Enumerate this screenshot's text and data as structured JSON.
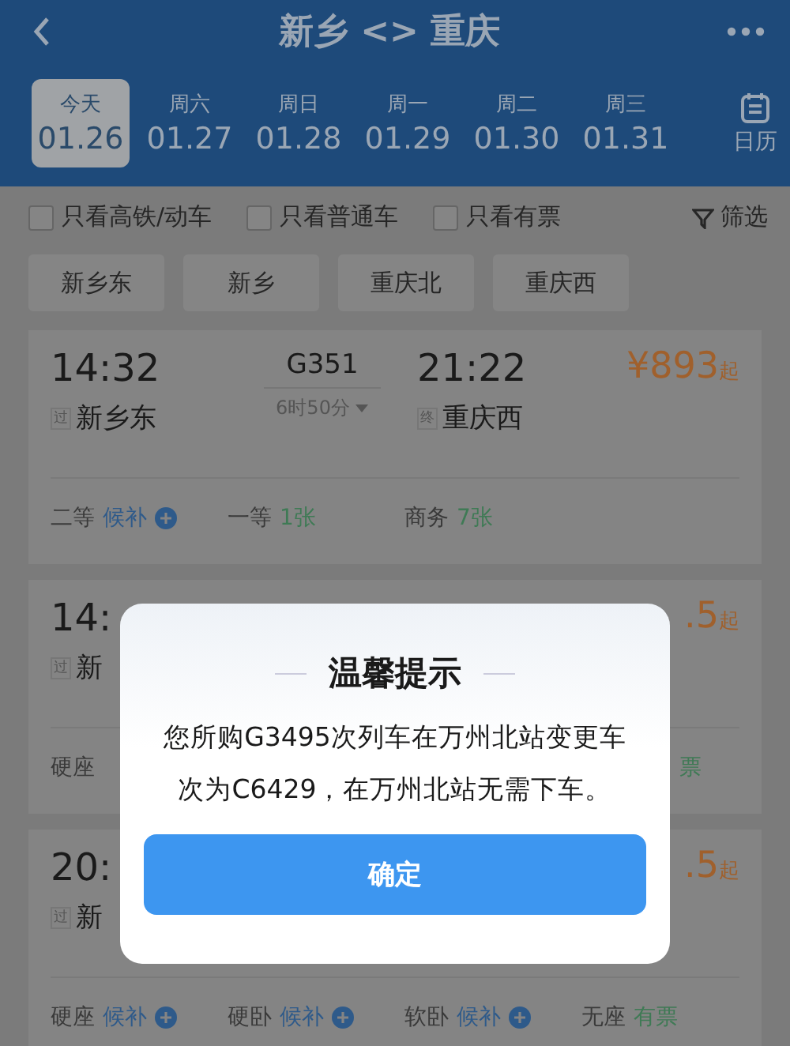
{
  "header": {
    "title": "新乡 <> 重庆"
  },
  "dates": [
    {
      "weekday": "今天",
      "date": "01.26",
      "selected": true
    },
    {
      "weekday": "周六",
      "date": "01.27",
      "selected": false
    },
    {
      "weekday": "周日",
      "date": "01.28",
      "selected": false
    },
    {
      "weekday": "周一",
      "date": "01.29",
      "selected": false
    },
    {
      "weekday": "周二",
      "date": "01.30",
      "selected": false
    },
    {
      "weekday": "周三",
      "date": "01.31",
      "selected": false
    }
  ],
  "calendar_label": "日历",
  "filters": [
    {
      "label": "只看高铁/动车",
      "checked": false
    },
    {
      "label": "只看普通车",
      "checked": false
    },
    {
      "label": "只看有票",
      "checked": false
    }
  ],
  "filter_button": "筛选",
  "stations": [
    {
      "label": "新乡东"
    },
    {
      "label": "新乡"
    },
    {
      "label": "重庆北"
    },
    {
      "label": "重庆西"
    }
  ],
  "trains": [
    {
      "depart_time": "14:32",
      "train_no": "G351",
      "duration": "6时50分",
      "arrive_time": "21:22",
      "depart_tag": "过",
      "depart_station": "新乡东",
      "arrive_tag": "终",
      "arrive_station": "重庆西",
      "price": "¥893",
      "price_suffix": "起",
      "seats": [
        {
          "class": "二等",
          "availability": "候补",
          "kind": "waitlist"
        },
        {
          "class": "一等",
          "availability": "1张",
          "kind": "tickets"
        },
        {
          "class": "商务",
          "availability": "7张",
          "kind": "tickets"
        }
      ]
    },
    {
      "depart_time": "14:",
      "depart_tag": "过",
      "depart_station": "新",
      "price": ".5",
      "price_suffix": "起",
      "seats": [
        {
          "class": "硬座"
        },
        {
          "availability": "票",
          "kind": "tickets"
        }
      ]
    },
    {
      "depart_time": "20:",
      "depart_tag": "过",
      "depart_station": "新",
      "price": ".5",
      "price_suffix": "起",
      "seats": [
        {
          "class": "硬座",
          "availability": "候补",
          "kind": "waitlist"
        },
        {
          "class": "硬卧",
          "availability": "候补",
          "kind": "waitlist"
        },
        {
          "class": "软卧",
          "availability": "候补",
          "kind": "waitlist"
        },
        {
          "class": "无座",
          "availability": "有票",
          "kind": "tickets"
        }
      ]
    }
  ],
  "dialog": {
    "title": "温馨提示",
    "message": "您所购G3495次列车在万州北站变更车次为C6429，在万州北站无需下车。",
    "button": "确定"
  }
}
